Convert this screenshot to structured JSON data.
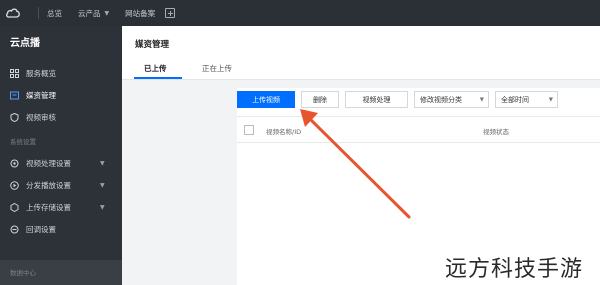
{
  "topbar": {
    "nav": [
      {
        "label": "总览"
      },
      {
        "label": "云产品"
      },
      {
        "label": "网站备案"
      }
    ]
  },
  "sidebar": {
    "title": "云点播",
    "items": [
      {
        "label": "服务概览"
      },
      {
        "label": "媒资管理"
      },
      {
        "label": "视频审核"
      }
    ],
    "group_label": "系统设置",
    "settings": [
      {
        "label": "视频处理设置"
      },
      {
        "label": "分发播放设置"
      },
      {
        "label": "上传存储设置"
      },
      {
        "label": "回调设置"
      }
    ],
    "bottom_group_label": "数据中心"
  },
  "main": {
    "title": "媒资管理",
    "tabs": [
      {
        "label": "已上传"
      },
      {
        "label": "正在上传"
      }
    ],
    "toolbar": {
      "upload": "上传视频",
      "delete": "删除",
      "process": "视频处理",
      "category": "修改视频分类",
      "time_filter": "全部时间"
    },
    "table": {
      "columns": [
        "视频名称/ID",
        "视频状态"
      ]
    }
  },
  "watermark": "远方科技手游",
  "colors": {
    "primary": "#006eff",
    "sidebar_bg": "#2d3138",
    "topbar_bg": "#2b2f36",
    "arrow": "#e8542f"
  }
}
